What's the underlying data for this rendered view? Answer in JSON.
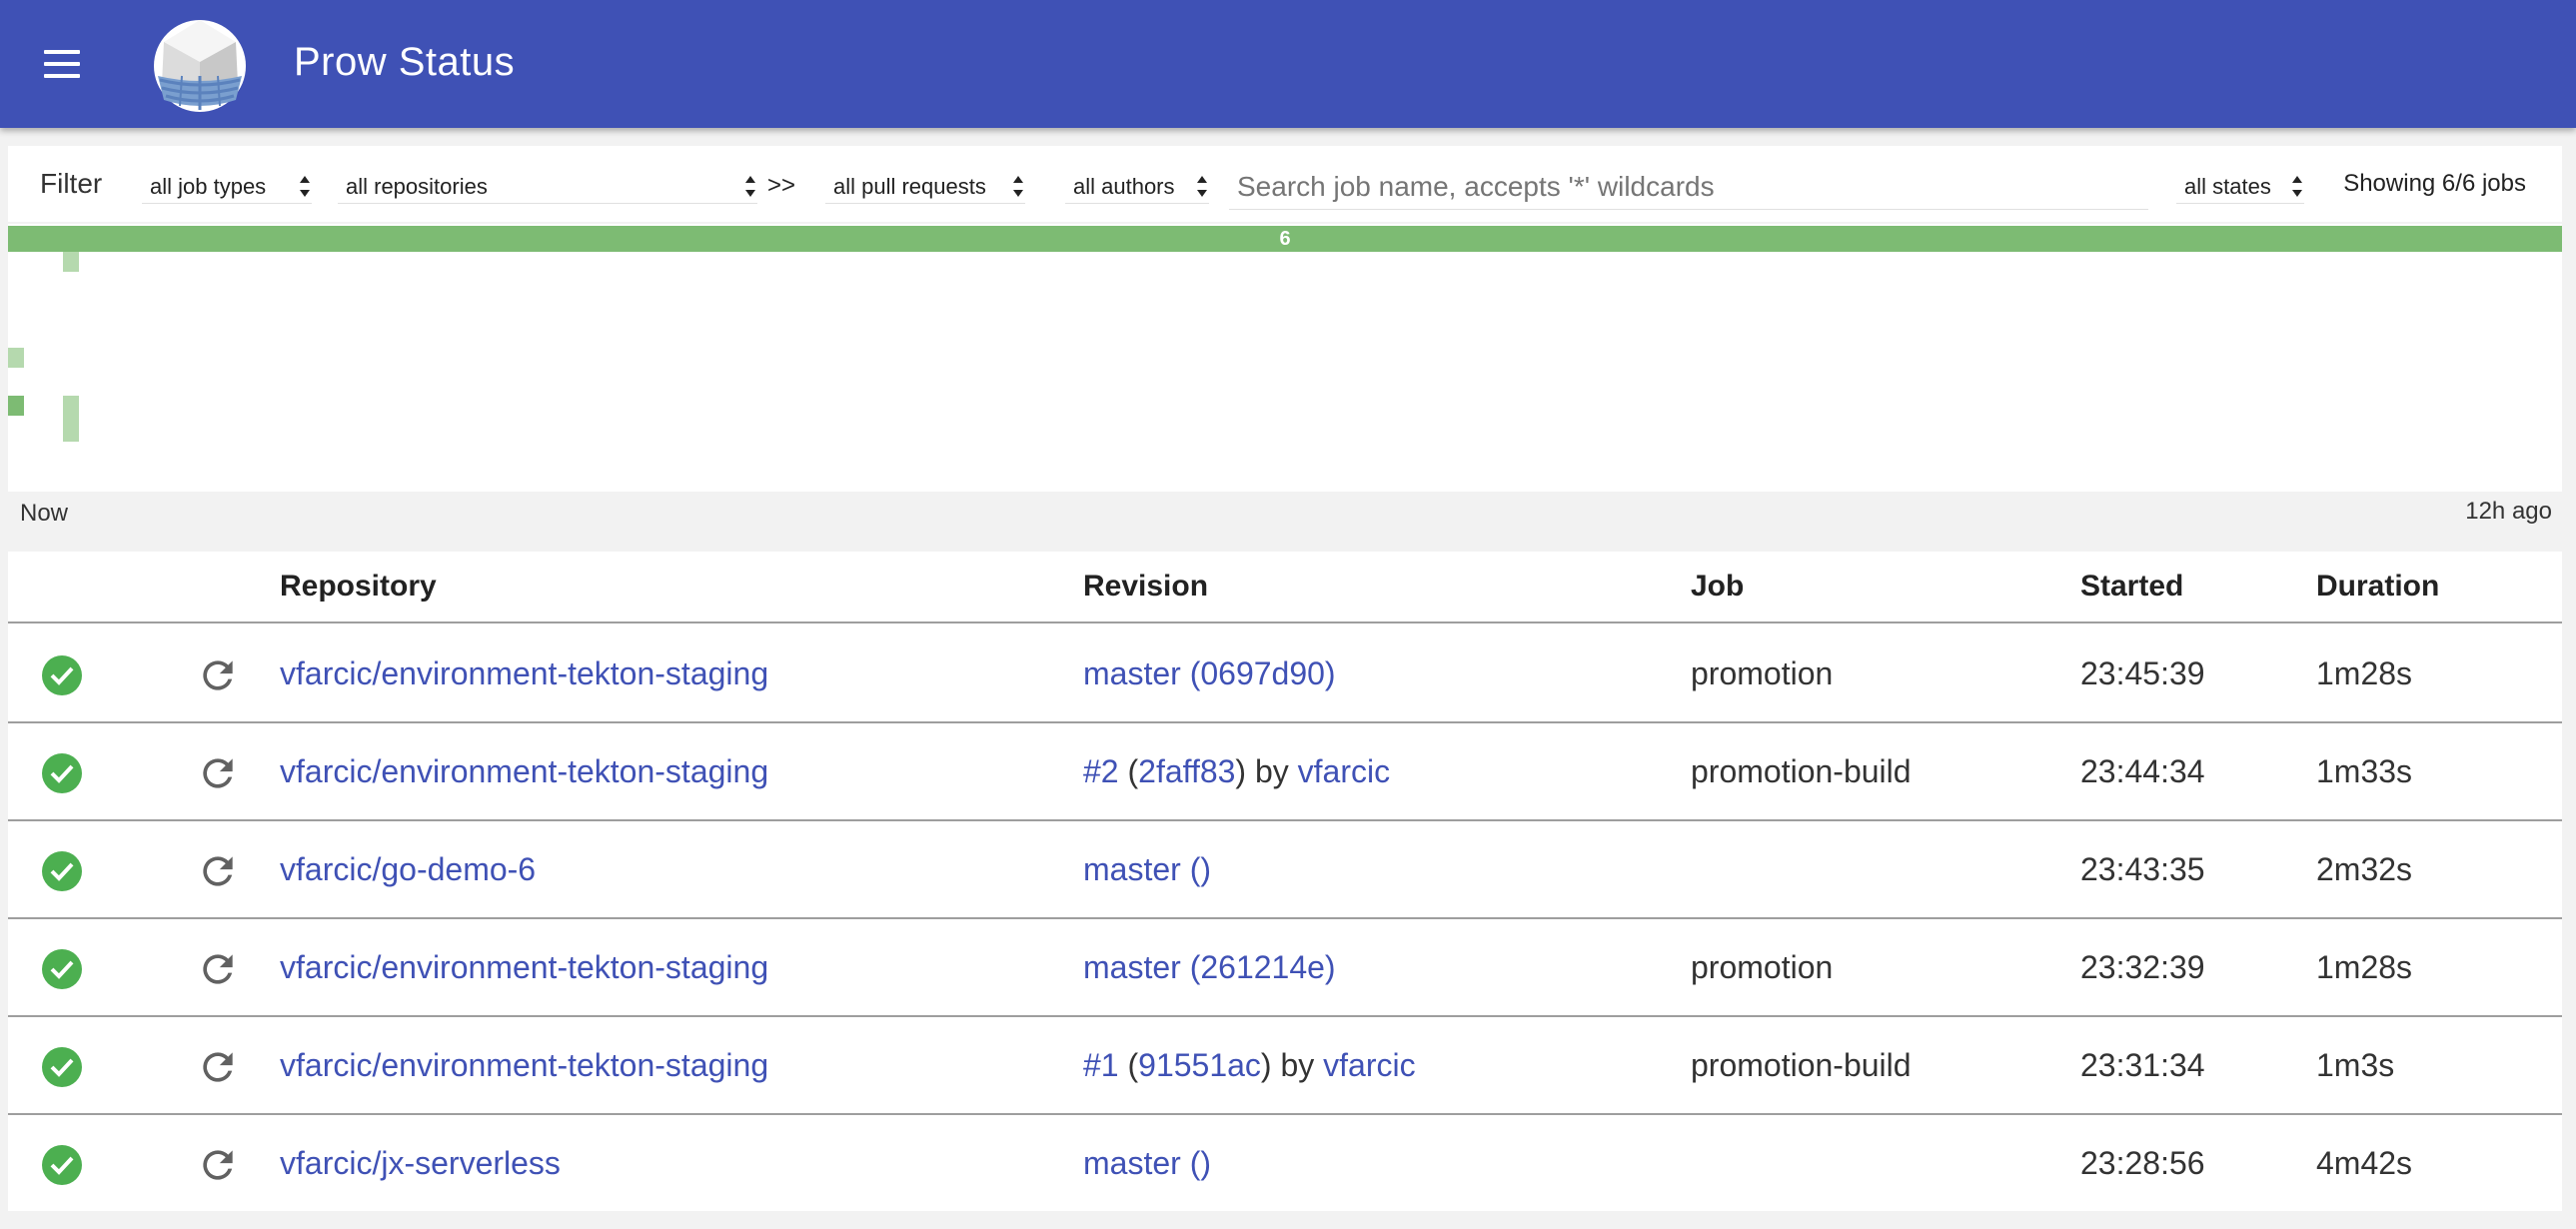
{
  "header": {
    "title": "Prow Status",
    "menu_icon": "hamburger-menu-icon",
    "logo_icon": "prow-ship-logo"
  },
  "filter": {
    "label": "Filter",
    "job_types": "all job types",
    "repositories": "all repositories",
    "chevron": ">>",
    "pull_requests": "all pull requests",
    "authors": "all authors",
    "search_placeholder": "Search job name, accepts '*' wildcards",
    "states": "all states",
    "showing": "Showing 6/6 jobs"
  },
  "histogram": {
    "bar_count": "6",
    "left_label": "Now",
    "right_label": "12h ago",
    "success_color": "#7dbb73"
  },
  "table": {
    "headers": {
      "repository": "Repository",
      "revision": "Revision",
      "job": "Job",
      "started": "Started",
      "duration": "Duration"
    },
    "rows": [
      {
        "repo": "vfarcic/environment-tekton-staging",
        "rev_main": "master (0697d90)",
        "job": "promotion",
        "started": "23:45:39",
        "duration": "1m28s"
      },
      {
        "repo": "vfarcic/environment-tekton-staging",
        "pr": "#2",
        "open": " (",
        "sha": "2faff83",
        "close": ") by ",
        "author": "vfarcic",
        "job": "promotion-build",
        "started": "23:44:34",
        "duration": "1m33s"
      },
      {
        "repo": "vfarcic/go-demo-6",
        "rev_main": "master ()",
        "job": "",
        "started": "23:43:35",
        "duration": "2m32s"
      },
      {
        "repo": "vfarcic/environment-tekton-staging",
        "rev_main": "master (261214e)",
        "job": "promotion",
        "started": "23:32:39",
        "duration": "1m28s"
      },
      {
        "repo": "vfarcic/environment-tekton-staging",
        "pr": "#1",
        "open": " (",
        "sha": "91551ac",
        "close": ") by ",
        "author": "vfarcic",
        "job": "promotion-build",
        "started": "23:31:34",
        "duration": "1m3s"
      },
      {
        "repo": "vfarcic/jx-serverless",
        "rev_main": "master ()",
        "job": "",
        "started": "23:28:56",
        "duration": "4m42s"
      }
    ]
  }
}
